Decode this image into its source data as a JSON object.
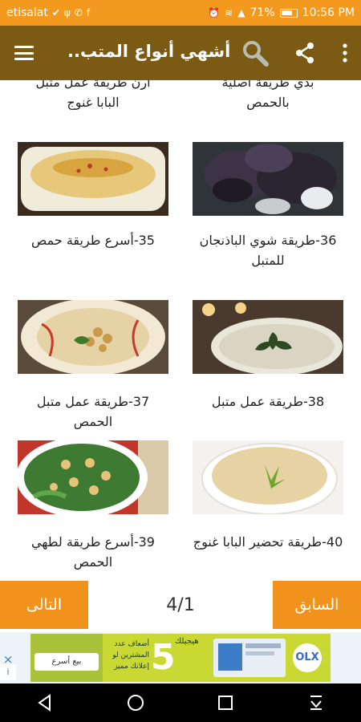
{
  "status": {
    "carrier": "etisalat",
    "battery": "71%",
    "time": "10:56 PM"
  },
  "appbar": {
    "title": "أشهي أنواع المتب..",
    "menu_icon": "hamburger-menu-icon",
    "search_icon": "search-icon",
    "share_icon": "share-icon",
    "more_icon": "more-vert-icon"
  },
  "partial_top": {
    "right_line1": "بدي طريقة أصلية",
    "right_line2": "بالحمص",
    "left_line1": "أرن طريقة عمل متبل",
    "left_line2": "البابا غنوج"
  },
  "cards": [
    {
      "caption": "36-طريقة شوي الباذنجان للمتبل"
    },
    {
      "caption": "35-أسرع طريقة حمص"
    },
    {
      "caption": "38-طريقة عمل متبل"
    },
    {
      "caption": "37-طريقة عمل متبل الحمص"
    },
    {
      "caption": "40-طريقة تحضير البابا غنوج"
    },
    {
      "caption": "39-أسرع طريقة لطهي الحمص"
    }
  ],
  "pager": {
    "next_label": "التالى",
    "prev_label": "السابق",
    "page_indicator": "4/1"
  },
  "ad": {
    "number": "5",
    "line1": "أضعاف عدد",
    "line2": "المشترين لو",
    "line3": "إعلانك مميز",
    "button": "بيع أسرع",
    "brand": "OLX",
    "top_text": "هيجيلك",
    "info": "i",
    "close": "×"
  },
  "colors": {
    "status_bar": "#f39a1e",
    "app_bar": "#7b5a13",
    "pager_button": "#f0921b"
  }
}
